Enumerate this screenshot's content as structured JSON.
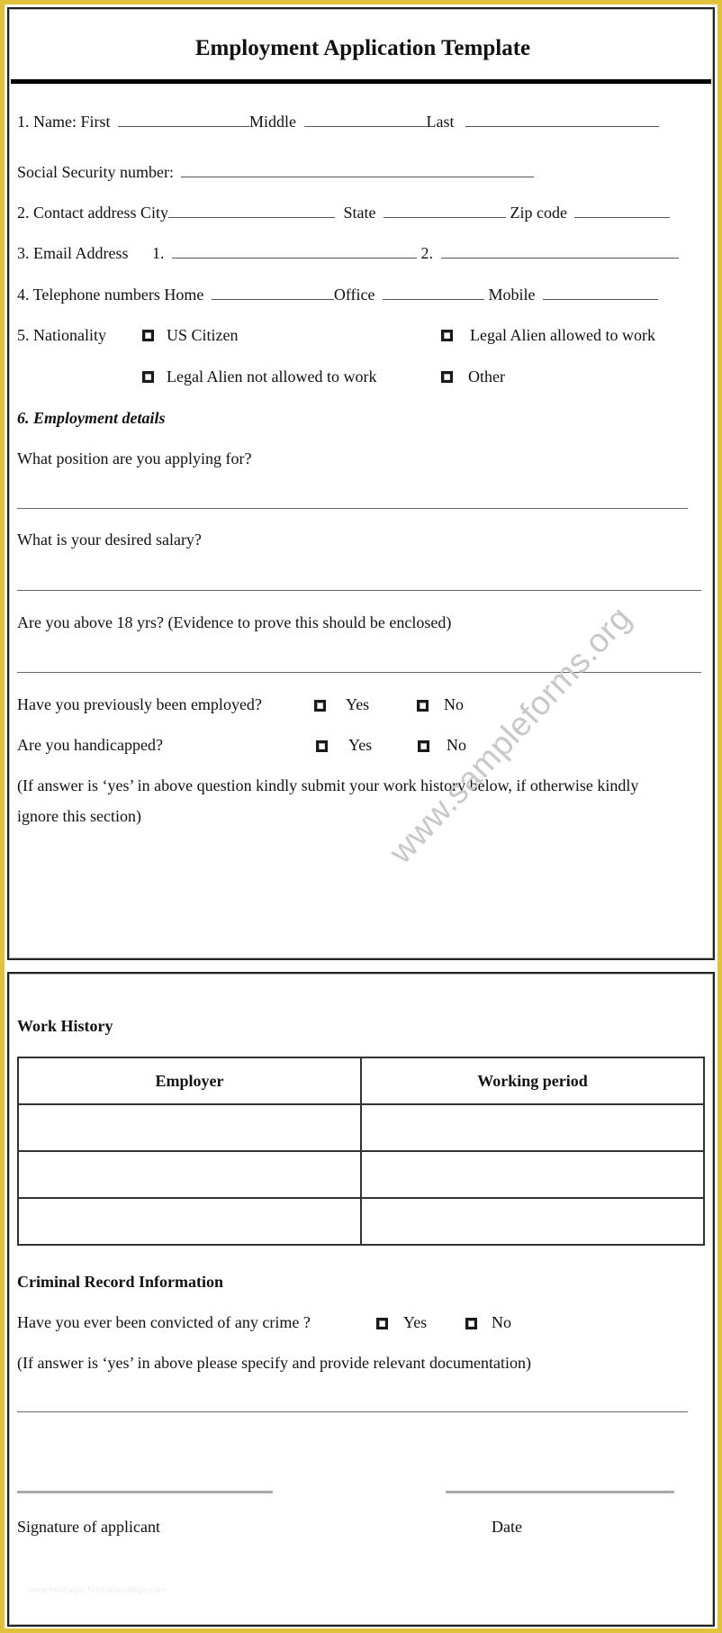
{
  "title": "Employment Application Template",
  "section1": {
    "name": {
      "label": "1. Name: First",
      "middle": "Middle",
      "last": "Last"
    },
    "ssn": {
      "label": "Social Security number:"
    },
    "contact": {
      "label": "2. Contact address  City",
      "state": "State",
      "zip": "Zip code"
    },
    "email": {
      "label": "3. Email Address",
      "one": "1.",
      "two": "2."
    },
    "phone": {
      "label": "4. Telephone numbers  Home",
      "office": "Office",
      "mobile": "Mobile"
    },
    "nationality": {
      "label": "5. Nationality",
      "options": [
        "US Citizen",
        "Legal Alien allowed to work",
        "Legal Alien not allowed to work",
        "Other"
      ]
    }
  },
  "employment": {
    "heading": "6. Employment details",
    "position_q": "What position are you applying for?",
    "salary_q": "What is your desired salary?",
    "age_q": "Are you above 18 yrs? (Evidence to prove this should be enclosed)",
    "previously_q": "Have you previously been employed?",
    "handicapped_q": "Are you handicapped?",
    "yes": "Yes",
    "no": "No",
    "note_line1": "(If answer is ‘yes’ in above question kindly submit your work history below, if otherwise kindly",
    "note_line2": "ignore this section)"
  },
  "work_history": {
    "heading": "Work History",
    "columns": [
      "Employer",
      "Working period"
    ],
    "rows": [
      [
        "",
        ""
      ],
      [
        "",
        ""
      ],
      [
        "",
        ""
      ]
    ]
  },
  "criminal": {
    "heading": "Criminal Record Information",
    "question": "Have you ever been convicted of any crime   ?",
    "yes": "Yes",
    "no": "No",
    "note": "(If answer is ‘yes’ in above please specify and provide relevant documentation)"
  },
  "signature": {
    "signature_label": "Signature of applicant",
    "date_label": "Date"
  },
  "watermarks": {
    "main": "www.sampleforms.org",
    "footer": "www.heritagechristiancollege.com"
  },
  "colors": {
    "frame": "#e2c23a",
    "border": "#222222",
    "watermark": "#c8c8c8"
  }
}
